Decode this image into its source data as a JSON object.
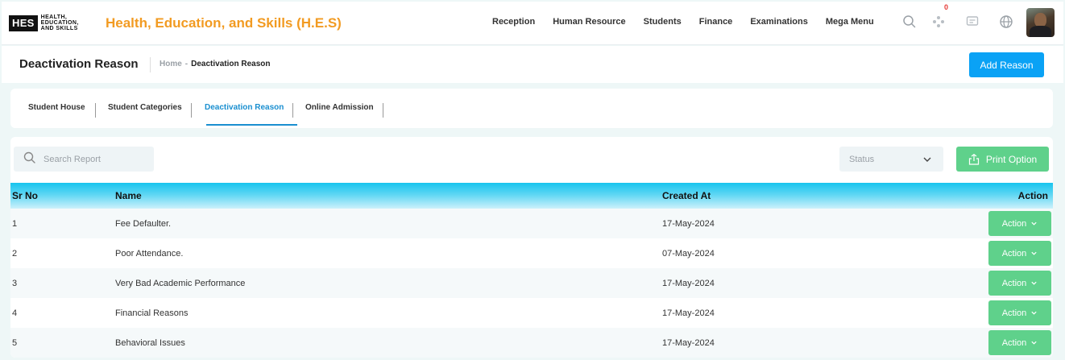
{
  "brand": {
    "logo_mark": "HES",
    "logo_lines": [
      "HEALTH,",
      "EDUCATION,",
      "AND SKILLS"
    ],
    "title": "Health, Education, and Skills (H.E.S)"
  },
  "nav": {
    "items": [
      "Reception",
      "Human Resource",
      "Students",
      "Finance",
      "Examinations",
      "Mega Menu"
    ],
    "notification_count": "0",
    "icons": [
      "search-icon",
      "apps-icon",
      "chat-icon",
      "globe-icon"
    ]
  },
  "header": {
    "title": "Deactivation Reason",
    "breadcrumb_home": "Home",
    "breadcrumb_sep": "-",
    "breadcrumb_current": "Deactivation Reason",
    "add_button": "Add Reason"
  },
  "tabs": [
    {
      "label": "Student House",
      "active": false
    },
    {
      "label": "Student Categories",
      "active": false
    },
    {
      "label": "Deactivation Reason",
      "active": true
    },
    {
      "label": "Online Admission",
      "active": false
    }
  ],
  "toolbar": {
    "search_placeholder": "Search Report",
    "status_placeholder": "Status",
    "print_label": "Print Option"
  },
  "table": {
    "columns": [
      "Sr No",
      "Name",
      "Created At",
      "Action"
    ],
    "rows": [
      {
        "sr": "1",
        "name": "Fee Defaulter.",
        "created": "17-May-2024",
        "action": "Action"
      },
      {
        "sr": "2",
        "name": "Poor Attendance.",
        "created": "07-May-2024",
        "action": "Action"
      },
      {
        "sr": "3",
        "name": "Very Bad Academic Performance",
        "created": "17-May-2024",
        "action": "Action"
      },
      {
        "sr": "4",
        "name": "Financial Reasons",
        "created": "17-May-2024",
        "action": "Action"
      },
      {
        "sr": "5",
        "name": "Behavioral Issues",
        "created": "17-May-2024",
        "action": "Action"
      }
    ]
  },
  "colors": {
    "brand_orange": "#f29b22",
    "primary_blue": "#0aa2f5",
    "success_green": "#5fd18b",
    "tab_active": "#1a8fd0",
    "header_cyan": "#17c4ee"
  }
}
